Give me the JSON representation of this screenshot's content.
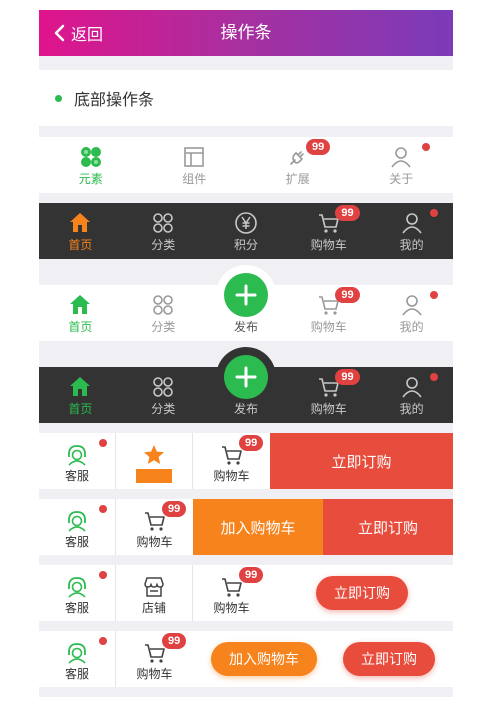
{
  "navbar": {
    "back_label": "返回",
    "title": "操作条",
    "gradient": [
      "#e0148c",
      "#7b3bb8"
    ]
  },
  "section": {
    "title": "底部操作条"
  },
  "colors": {
    "green": "#2bbb4f",
    "orange": "#f7831d",
    "red": "#e74c3c",
    "dark": "#333333"
  },
  "tabbar1": {
    "items": [
      {
        "label": "元素",
        "icon": "grid-blocks-icon"
      },
      {
        "label": "组件",
        "icon": "layout-icon"
      },
      {
        "label": "扩展",
        "icon": "plug-icon",
        "badge": "99"
      },
      {
        "label": "关于",
        "icon": "person-icon"
      }
    ]
  },
  "tabbar2": {
    "items": [
      {
        "label": "首页",
        "icon": "home-icon"
      },
      {
        "label": "分类",
        "icon": "category-icon"
      },
      {
        "label": "积分",
        "icon": "yen-circle-icon"
      },
      {
        "label": "购物车",
        "icon": "cart-icon",
        "badge": "99"
      },
      {
        "label": "我的",
        "icon": "person-icon"
      }
    ]
  },
  "tabbar3": {
    "items": [
      {
        "label": "首页",
        "icon": "home-icon"
      },
      {
        "label": "分类",
        "icon": "category-icon"
      },
      {
        "label": "发布",
        "icon": "plus-icon"
      },
      {
        "label": "购物车",
        "icon": "cart-icon",
        "badge": "99"
      },
      {
        "label": "我的",
        "icon": "person-icon"
      }
    ]
  },
  "tabbar4": {
    "items": [
      {
        "label": "首页",
        "icon": "home-icon"
      },
      {
        "label": "分类",
        "icon": "category-icon"
      },
      {
        "label": "发布",
        "icon": "plus-icon"
      },
      {
        "label": "购物车",
        "icon": "cart-icon",
        "badge": "99"
      },
      {
        "label": "我的",
        "icon": "person-icon"
      }
    ]
  },
  "bar1": {
    "service": "客服",
    "favorite": "已收藏",
    "cart": "购物车",
    "cart_badge": "99",
    "buy": "立即订购"
  },
  "bar2": {
    "service": "客服",
    "cart": "购物车",
    "cart_badge": "99",
    "add_cart": "加入购物车",
    "buy": "立即订购"
  },
  "bar3": {
    "service": "客服",
    "shop": "店铺",
    "cart": "购物车",
    "cart_badge": "99",
    "buy": "立即订购"
  },
  "bar4": {
    "service": "客服",
    "cart": "购物车",
    "cart_badge": "99",
    "add_cart": "加入购物车",
    "buy": "立即订购"
  }
}
